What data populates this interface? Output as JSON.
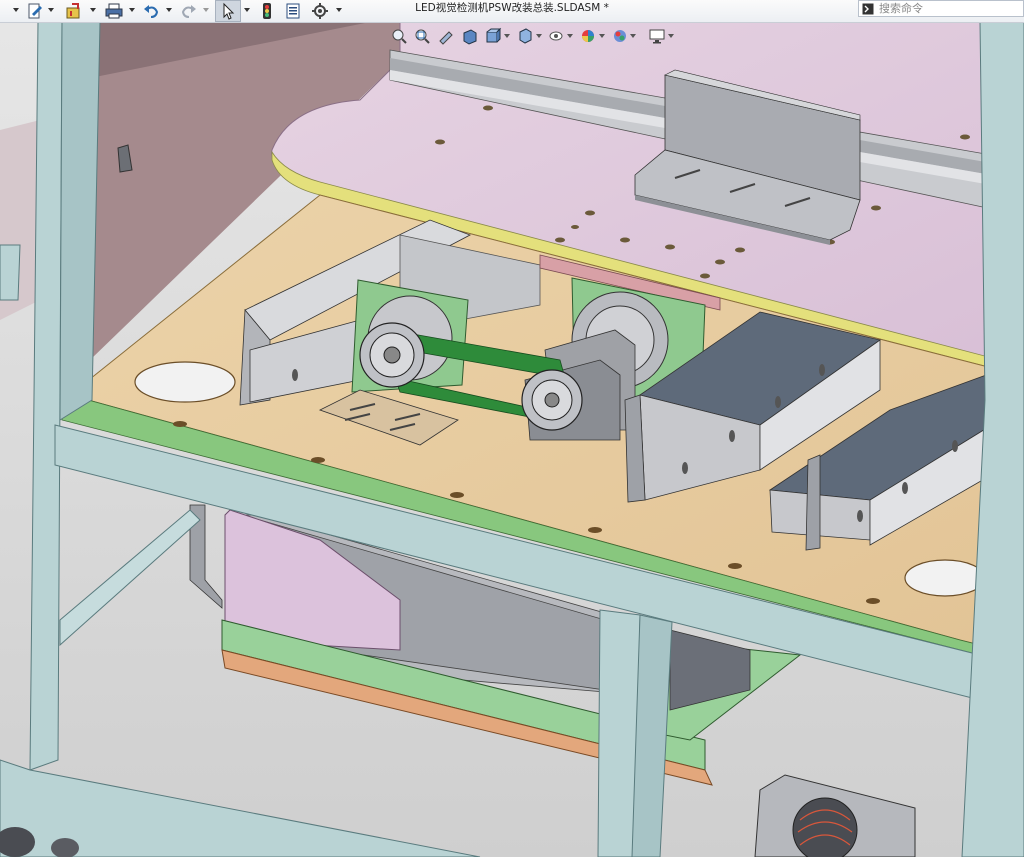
{
  "window": {
    "title": "LED视觉检测机PSW改装总装.SLDASM *"
  },
  "search": {
    "placeholder": "搜索命令"
  },
  "toolbar": {
    "icons": [
      "new-document-icon",
      "rebuild-icon",
      "print-icon",
      "undo-icon",
      "redo-icon",
      "select-arrow-icon",
      "traffic-light-icon",
      "file-properties-icon",
      "options-gear-icon"
    ]
  },
  "view_toolbar": {
    "icons": [
      "zoom-to-fit-icon",
      "zoom-to-area-icon",
      "previous-view-icon",
      "section-view-icon",
      "view-orientation-icon",
      "display-style-icon",
      "hide-show-items-icon",
      "edit-appearance-icon",
      "apply-scene-icon",
      "view-settings-icon"
    ]
  },
  "colors": {
    "frame": "#b9d3d4",
    "plate_wood": "#e8cda1",
    "plate_pink": "#dcc3d9",
    "green_part": "#8fc98f",
    "belt": "#2e8b3a",
    "gray_part": "#c7c8cc",
    "orange_strip": "#e3a77c"
  }
}
